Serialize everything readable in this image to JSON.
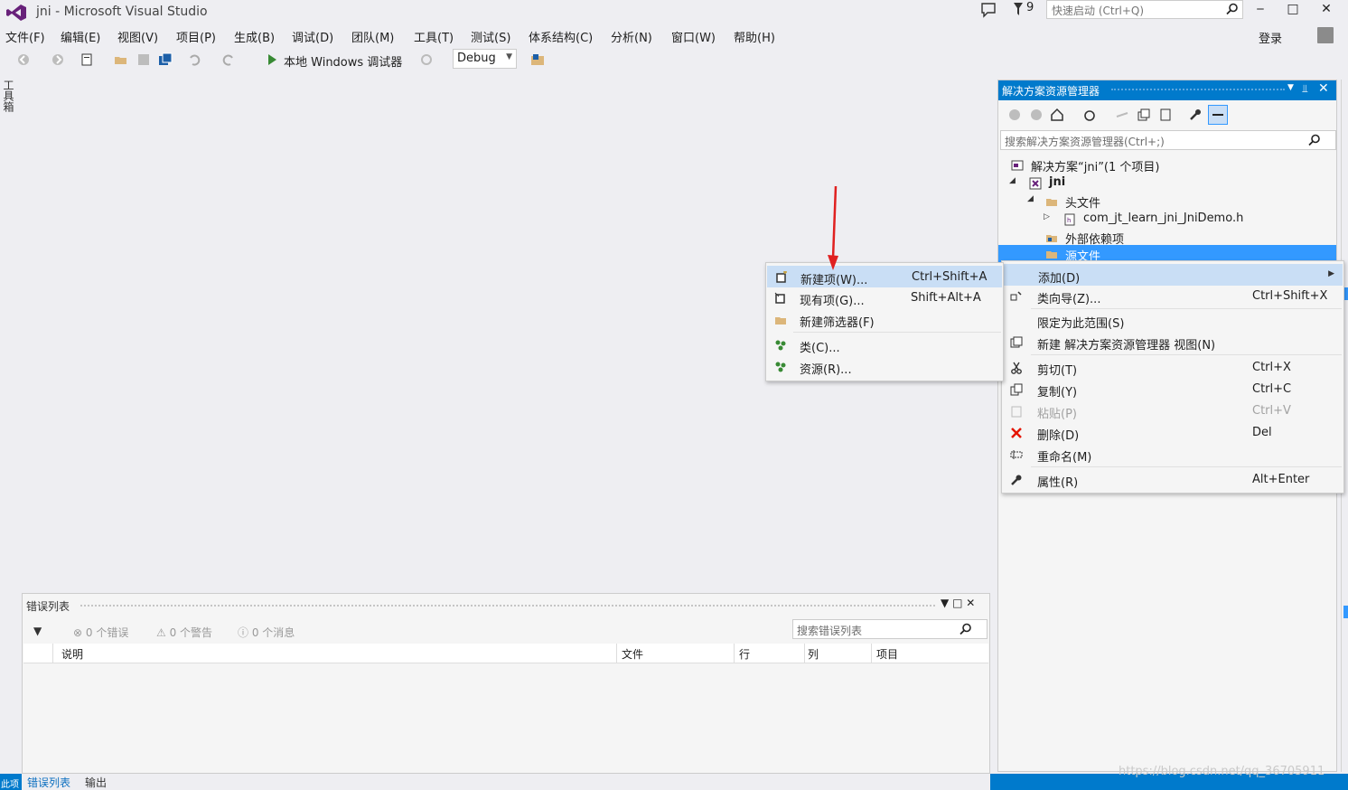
{
  "colors": {
    "accent": "#007acc",
    "selection": "#3399ff",
    "menu_hover": "#c9def5",
    "arrow": "#e02020",
    "vs_purple": "#68217a"
  },
  "titlebar": {
    "title": "jni - Microsoft Visual Studio",
    "notification_count": "9",
    "quick_launch_placeholder": "快速启动 (Ctrl+Q)"
  },
  "menubar": {
    "items": [
      "文件(F)",
      "编辑(E)",
      "视图(V)",
      "项目(P)",
      "生成(B)",
      "调试(D)",
      "团队(M)",
      "工具(T)",
      "测试(S)",
      "体系结构(C)",
      "分析(N)",
      "窗口(W)",
      "帮助(H)"
    ],
    "login": "登录"
  },
  "toolbar": {
    "run_label": "本地 Windows 调试器",
    "config_value": "Debug"
  },
  "toolbox": {
    "label": "工具箱"
  },
  "solution_explorer": {
    "title": "解决方案资源管理器",
    "search_placeholder": "搜索解决方案资源管理器(Ctrl+;)",
    "tree": [
      {
        "label": "解决方案“jni”(1 个项目)",
        "icon": "solution-icon"
      },
      {
        "label": "jni",
        "icon": "project-icon"
      },
      {
        "label": "头文件",
        "icon": "filter-folder-icon"
      },
      {
        "label": "com_jt_learn_jni_JniDemo.h",
        "icon": "header-file-icon"
      },
      {
        "label": "外部依赖项",
        "icon": "external-deps-icon"
      },
      {
        "label": "源文件",
        "icon": "filter-folder-icon"
      }
    ]
  },
  "context_menu": {
    "items": [
      {
        "label": "添加(D)",
        "shortcut": ""
      },
      {
        "label": "类向导(Z)...",
        "shortcut": "Ctrl+Shift+X"
      },
      {
        "label": "限定为此范围(S)",
        "shortcut": ""
      },
      {
        "label": "新建 解决方案资源管理器 视图(N)",
        "shortcut": ""
      },
      {
        "label": "剪切(T)",
        "shortcut": "Ctrl+X"
      },
      {
        "label": "复制(Y)",
        "shortcut": "Ctrl+C"
      },
      {
        "label": "粘贴(P)",
        "shortcut": "Ctrl+V"
      },
      {
        "label": "删除(D)",
        "shortcut": "Del"
      },
      {
        "label": "重命名(M)",
        "shortcut": ""
      },
      {
        "label": "属性(R)",
        "shortcut": "Alt+Enter"
      }
    ]
  },
  "add_submenu": {
    "items": [
      {
        "label": "新建项(W)...",
        "shortcut": "Ctrl+Shift+A"
      },
      {
        "label": "现有项(G)...",
        "shortcut": "Shift+Alt+A"
      },
      {
        "label": "新建筛选器(F)",
        "shortcut": ""
      },
      {
        "label": "类(C)...",
        "shortcut": ""
      },
      {
        "label": "资源(R)...",
        "shortcut": ""
      }
    ]
  },
  "error_list": {
    "title": "错误列表",
    "errors": "0 个错误",
    "warnings": "0 个警告",
    "messages": "0 个消息",
    "search_placeholder": "搜索错误列表",
    "columns": [
      "说明",
      "文件",
      "行",
      "列",
      "项目"
    ]
  },
  "bottom_tabs": [
    "错误列表",
    "输出"
  ],
  "status_left": "此项",
  "watermark": "https://blog.csdn.net/qq_36705911"
}
